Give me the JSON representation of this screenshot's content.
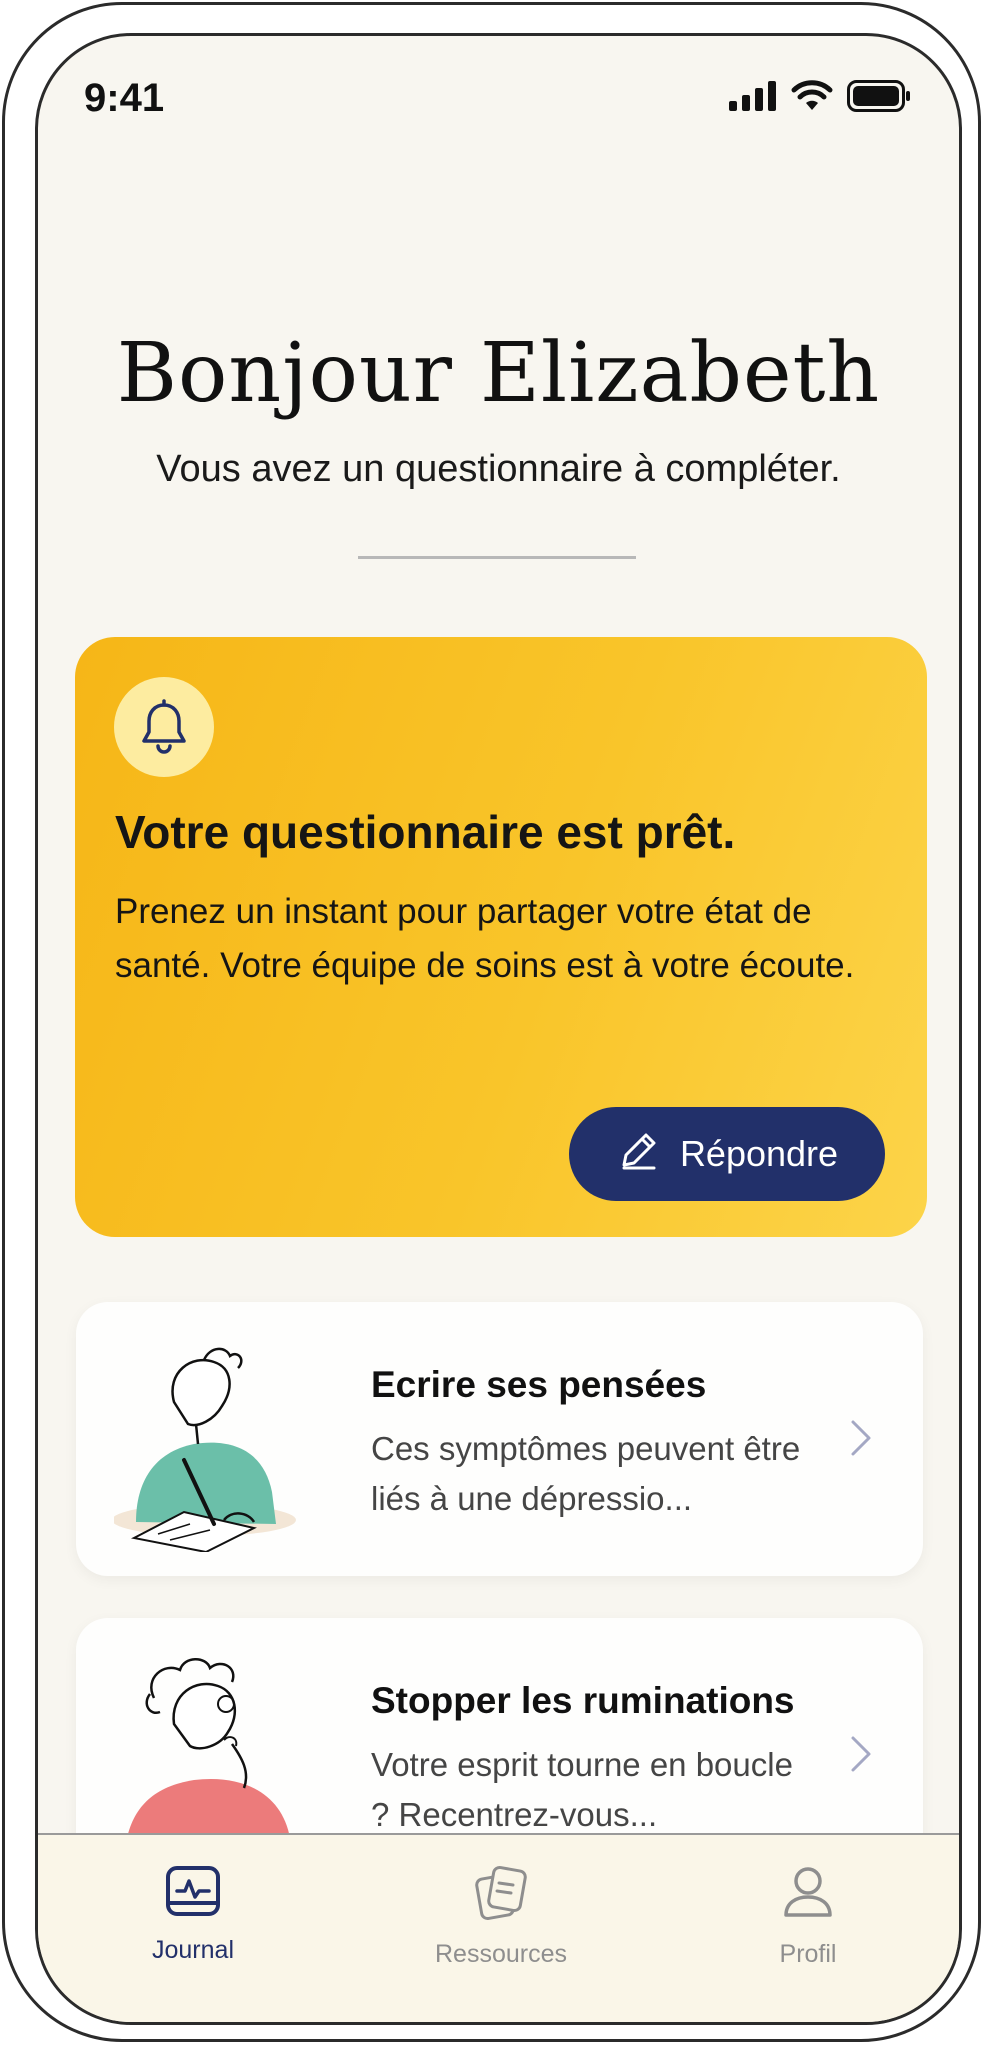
{
  "status_bar": {
    "time": "9:41"
  },
  "header": {
    "greeting": "Bonjour Elizabeth",
    "subtitle": "Vous avez un questionnaire à compléter."
  },
  "alert_card": {
    "icon": "bell-icon",
    "title": "Votre questionnaire est prêt.",
    "body": "Prenez un instant pour partager votre état de santé. Votre équipe de soins est à votre écoute.",
    "button_label": "Répondre",
    "button_icon": "pencil-icon"
  },
  "cards": [
    {
      "title": "Ecrire ses pensées",
      "description": "Ces symptômes peuvent être liés à une dépressio...",
      "illustration": "person-writing-illustration"
    },
    {
      "title": "Stopper les ruminations",
      "description": "Votre esprit tourne en boucle ? Recentrez-vous...",
      "illustration": "person-thinking-illustration"
    }
  ],
  "bottom_nav": {
    "items": [
      {
        "label": "Journal",
        "icon": "journal-icon",
        "active": true
      },
      {
        "label": "Ressources",
        "icon": "documents-icon",
        "active": false
      },
      {
        "label": "Profil",
        "icon": "user-icon",
        "active": false
      }
    ]
  },
  "colors": {
    "background": "#f8f6f0",
    "accent_yellow": "#f9c52a",
    "primary_navy": "#22306a",
    "inactive_gray": "#8e8e8e"
  }
}
